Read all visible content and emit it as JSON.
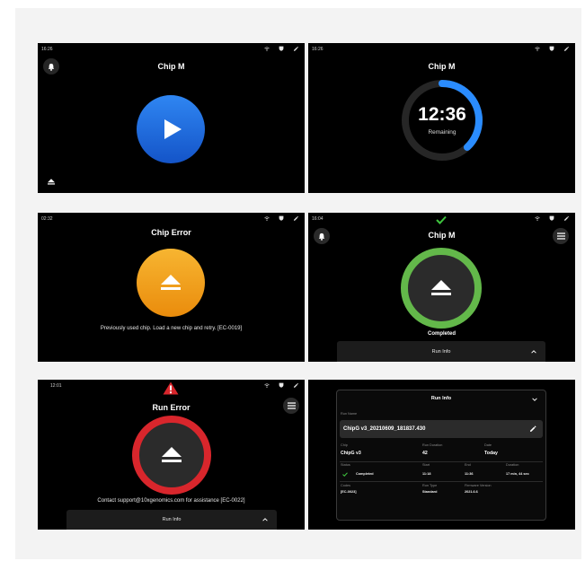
{
  "panels": {
    "ready": {
      "time": "16:26",
      "title": "Chip M"
    },
    "running": {
      "time": "16:26",
      "title": "Chip M",
      "timer": "12:36",
      "timer_label": "Remaining",
      "progress_pct": 0.38
    },
    "chip_error": {
      "time": "02:32",
      "title": "Chip Error",
      "message": "Previously used chip. Load a new chip and retry. [EC-0019]"
    },
    "completed": {
      "time": "16:04",
      "title": "Chip M",
      "status": "Completed",
      "run_info_label": "Run Info"
    },
    "run_error": {
      "time": "12:01",
      "title": "Run Error",
      "message": "Contact support@10xgenomics.com for assistance [EC-0022]",
      "run_info_label": "Run Info"
    },
    "run_info": {
      "header": "Run Info",
      "run_name_label": "Run Name",
      "run_name": "ChipG v3_20210609_181837.430",
      "chip_label": "Chip",
      "chip": "ChipG v3",
      "run_duration_label": "Run Duration",
      "run_duration": "42",
      "date_label": "Date",
      "date": "Today",
      "status_label": "Status",
      "status": "Completed",
      "start_label": "Start",
      "start": "11:18",
      "end_label": "End",
      "end": "11:36",
      "duration_label": "Duration",
      "duration": "17 min, 44 sec",
      "codes_label": "Codes",
      "codes": "[EC-0023]",
      "run_type_label": "Run Type",
      "run_type": "Standard",
      "firmware_label": "Firmware Version",
      "firmware": "2021.6.6"
    }
  },
  "colors": {
    "play_blue": "#1f6fe0",
    "progress_blue": "#2a8cff",
    "warning_orange": "#f4a11c",
    "success_green": "#63b84a",
    "error_red": "#d8262c",
    "check_green": "#3ec43e"
  },
  "icons": [
    "bell-icon",
    "wifi-icon",
    "shield-icon",
    "pen-icon",
    "play-icon",
    "eject-icon",
    "check-icon",
    "warning-icon",
    "menu-icon",
    "chevron-up-icon",
    "chevron-down-icon",
    "edit-icon"
  ]
}
